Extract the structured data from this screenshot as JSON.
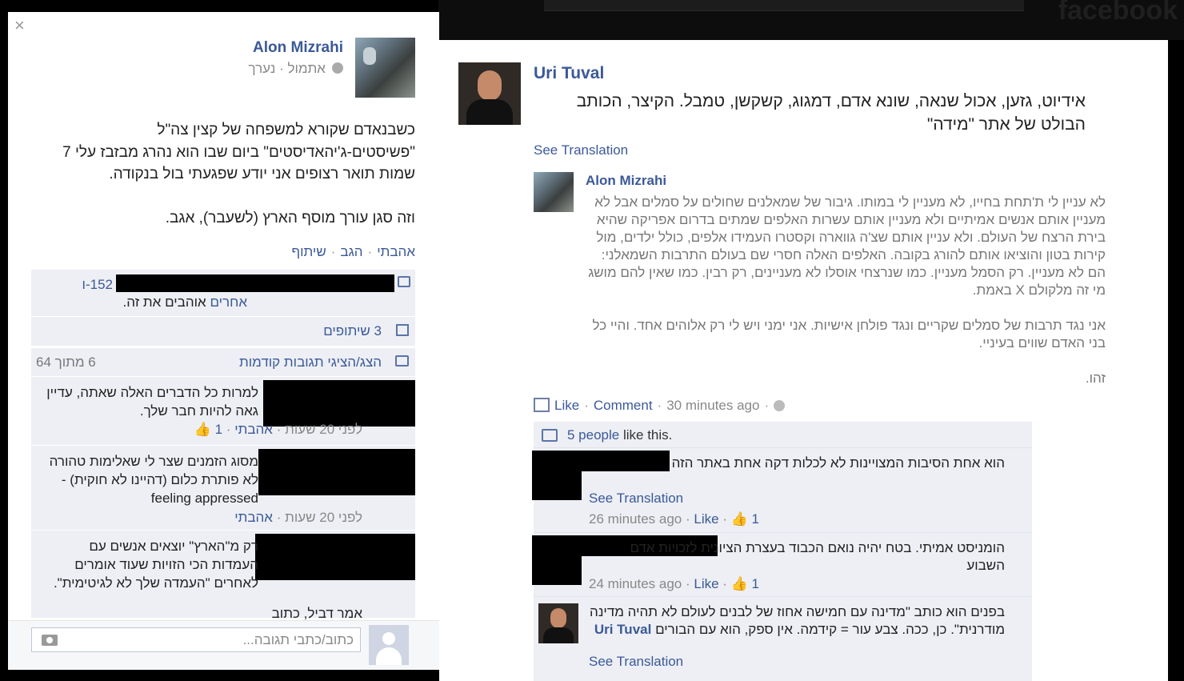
{
  "left_panel": {
    "close_label": "×",
    "post": {
      "author": "Alon Mizrahi",
      "meta": "אתמול · נערך",
      "text_p1": "כשבנאדם שקורא למשפחה של קצין צה\"ל \"פשיסטים-ג'יהאדיסטים\" ביום שבו הוא נהרג מבזבז עלי 7 שמות תואר רצופים אני יודע שפגעתי בול בנקודה.",
      "text_p2": "וזה סגן עורך מוסף הארץ (לשעבר), אגב.",
      "actions": {
        "like": "אהבתי",
        "comment": "הגב",
        "share": "שיתוף"
      }
    },
    "ufi": {
      "likes_count": "152-ו",
      "likes_others_link": "אחרים",
      "likes_others_text": " אוהבים את זה.",
      "shares": "3 שיתופים",
      "view_previous": "הצג/הציגי תגובות קודמות",
      "count": "6 מתוך 64",
      "comments": [
        {
          "text": "למרות כל הדברים האלה שאתה, עדיין גאה להיות חבר שלך.",
          "time": "לפני 20 שעות",
          "like": "אהבתי",
          "likes": "1"
        },
        {
          "text": "מסוג הזמנים שצר לי שאלימות טהורה לא פותרת כלום (דהיינו לא חוקית) - feeling appressed",
          "time": "לפני 20 שעות",
          "like": "אהבתי"
        },
        {
          "text": "רק מ\"הארץ\" יוצאים אנשים עם העמדות הכי הזויות שעוד אומרים לאחרים \"העמדה שלך לא לגיטימית\".",
          "extra": "אמר דביל, כתוב"
        }
      ]
    },
    "write_placeholder": "כתוב/כתבי תגובה..."
  },
  "right_panel": {
    "author": "Uri Tuval",
    "text": "אידיוט, גזען, אכול שנאה, שונא אדם, דמגוג, קשקשן, טמבל. הקיצר, הכותב הבולט של אתר \"מידה\"",
    "see_translation": "See Translation",
    "shared": {
      "author": "Alon Mizrahi",
      "p1": "לא עניין לי ת'תחת בחייו, לא מעניין לי במותו. גיבור של שמאלנים שחולים על סמלים אבל לא מעניין אותם אנשים אמיתיים ולא מעניין אותם עשרות האלפים שמתים בדרום אפריקה שהיא בירת הרצח של העולם. ולא עניין אותם שצ'ה גווארה וקסטרו העמידו אלפים, כולל ילדים, מול קירות בטון והוציאו אותם להורג בקובה. האלפים האלה חסרי שם בעולם התרבות השמאלני: הם לא מעניין. רק הסמל מעניין. כמו שנרצחי אוסלו לא מעניינים, רק רבין. כמו שאין להם מושג מי זה מלקולם X באמת.",
      "p2": "אני נגד תרבות של סמלים שקריים ונגד פולחן אישיות. אני ימני ויש לי רק אלוהים אחד. והיי כל בני האדם שווים בעיניי.",
      "p3": "זהו."
    },
    "actions": {
      "like": "Like",
      "comment": "Comment",
      "time": "30 minutes ago"
    },
    "likes_link": "5 people",
    "likes_text": " like this.",
    "comments": [
      {
        "text": "הוא אחת הסיבות המצויינות לא לכלות דקה אחת באתר הזה",
        "see_translation": "See Translation",
        "time": "26 minutes ago",
        "like": "Like",
        "likes": "1"
      },
      {
        "text": "הומניסט אמיתי. בטח יהיה נואם הכבוד בעצרת הציונית לזכויות אדם השבוע",
        "time": "24 minutes ago",
        "like": "Like",
        "likes": "1"
      },
      {
        "author": "Uri Tuval",
        "text": "בפנים הוא כותב \"מדינה עם חמישה אחוז של לבנים לעולם לא תהיה מדינה מודרנית\". כן, ככה. צבע עור = קידמה. אין ספק, הוא עם הבורים",
        "see_translation": "See Translation"
      }
    ]
  }
}
